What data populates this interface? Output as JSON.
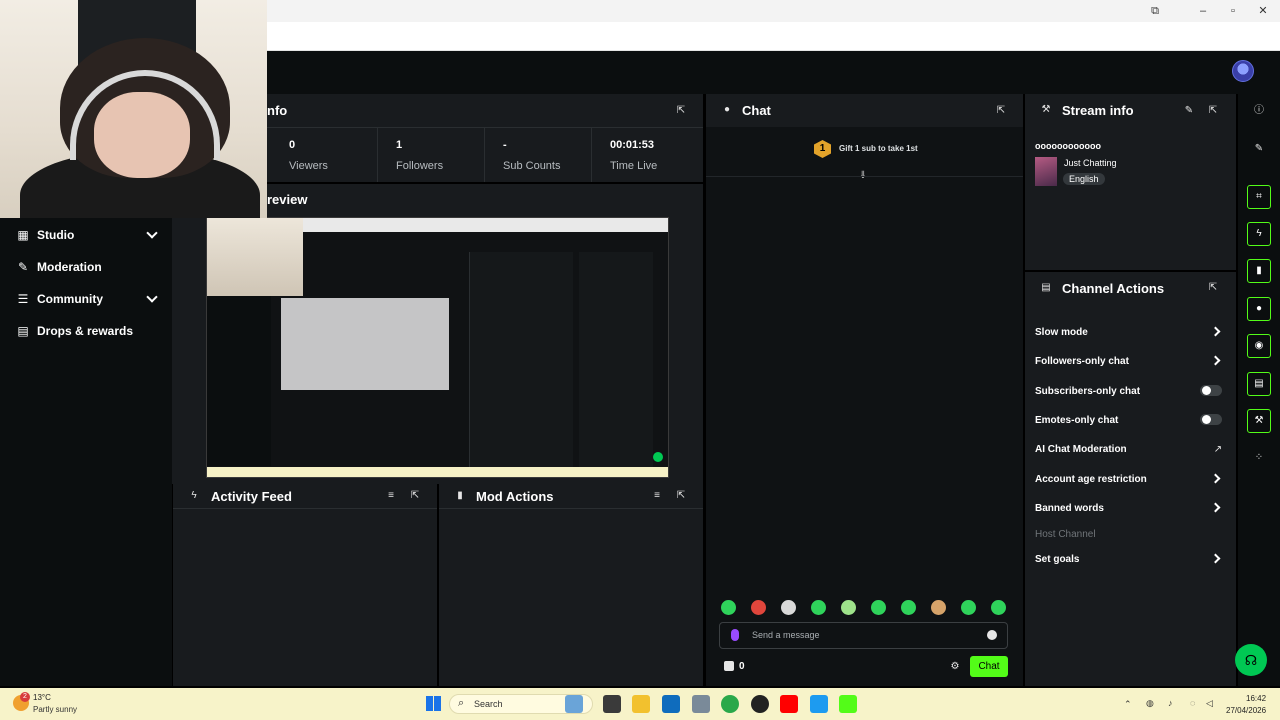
{
  "stats": {
    "title_fragment": "nfo",
    "viewers": {
      "value": "0",
      "label": "Viewers"
    },
    "followers": {
      "value": "1",
      "label": "Followers"
    },
    "sub_counts": {
      "value": "-",
      "label": "Sub Counts"
    },
    "time_live": {
      "value": "00:01:53",
      "label": "Time Live"
    }
  },
  "preview": {
    "title_fragment": "review"
  },
  "sidebar": {
    "items": [
      {
        "label": "Studio",
        "icon": "studio-icon"
      },
      {
        "label": "Moderation",
        "icon": "moderation-icon"
      },
      {
        "label": "Community",
        "icon": "community-icon"
      },
      {
        "label": "Drops & rewards",
        "icon": "drops-icon"
      }
    ]
  },
  "activity_feed": {
    "title": "Activity Feed"
  },
  "mod_actions": {
    "title": "Mod Actions"
  },
  "chat": {
    "title": "Chat",
    "gift_badge": "1",
    "gift_text": "Gift 1 sub to take 1st",
    "input_placeholder": "Send a message",
    "count": "0",
    "send_label": "Chat"
  },
  "stream_info": {
    "title": "Stream info",
    "stream_title": "oooooooooooo",
    "category": "Just Chatting",
    "language": "English"
  },
  "channel_actions": {
    "title": "Channel Actions",
    "items": [
      {
        "label": "Slow mode",
        "control": "chevron"
      },
      {
        "label": "Followers-only chat",
        "control": "chevron"
      },
      {
        "label": "Subscribers-only chat",
        "control": "toggle"
      },
      {
        "label": "Emotes-only chat",
        "control": "toggle"
      },
      {
        "label": "AI Chat Moderation",
        "control": "external"
      },
      {
        "label": "Account age restriction",
        "control": "chevron"
      },
      {
        "label": "Banned words",
        "control": "chevron"
      },
      {
        "label": "Host Channel",
        "control": "none"
      },
      {
        "label": "Set goals",
        "control": "chevron"
      }
    ]
  },
  "taskbar": {
    "weather_temp": "13°C",
    "weather_desc": "Partly sunny",
    "search": "Search",
    "time": "16:42",
    "date": "27/04/2026",
    "weather_badge": "2"
  },
  "colors": {
    "accent": "#53fc18",
    "panel": "#181b1e",
    "background": "#000000"
  }
}
